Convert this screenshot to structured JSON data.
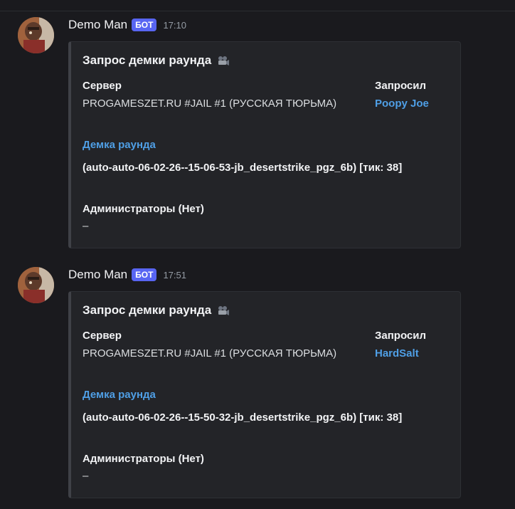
{
  "messages": [
    {
      "author": "Demo Man",
      "tag": "БОТ",
      "time": "17:10",
      "embed": {
        "title": "Запрос демки раунда",
        "title_icon": "movie-camera-icon",
        "fields": {
          "server_name": "Сервер",
          "server_value": "PROGAMESZET.RU #JAIL #1 (РУССКАЯ ТЮРЬМА)",
          "requested_name": "Запросил",
          "requested_value": "Poopy Joe",
          "demo_name": "Демка раунда",
          "demo_value": "(auto-auto-06-02-26--15-06-53-jb_desertstrike_pgz_6b) [тик: 38]",
          "admins_name": "Администраторы (Нет)",
          "admins_value": "–"
        }
      }
    },
    {
      "author": "Demo Man",
      "tag": "БОТ",
      "time": "17:51",
      "embed": {
        "title": "Запрос демки раунда",
        "title_icon": "movie-camera-icon",
        "fields": {
          "server_name": "Сервер",
          "server_value": "PROGAMESZET.RU #JAIL #1 (РУССКАЯ ТЮРЬМА)",
          "requested_name": "Запросил",
          "requested_value": "HardSalt",
          "demo_name": "Демка раунда",
          "demo_value": "(auto-auto-06-02-26--15-50-32-jb_desertstrike_pgz_6b) [тик: 38]",
          "admins_name": "Администраторы (Нет)",
          "admins_value": "–"
        }
      }
    }
  ],
  "colors": {
    "background": "#1a1a1e",
    "embed_background": "#232428",
    "bot_tag": "#5865f2",
    "link": "#4f9fe6"
  }
}
